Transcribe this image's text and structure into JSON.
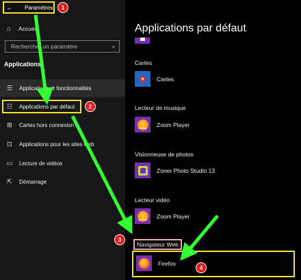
{
  "titlebar": {
    "back_glyph": "←",
    "title": "Paramètres"
  },
  "left": {
    "home_label": "Accueil",
    "search_placeholder": "Rechercher un paramètre",
    "section_heading": "Applications",
    "items": [
      {
        "label": "Applications et fonctionnalités",
        "icon": "apps-list-icon",
        "glyph": "☰"
      },
      {
        "label": "Applications par défaut",
        "icon": "default-apps-icon",
        "glyph": "☷"
      },
      {
        "label": "Cartes hors connexion",
        "icon": "offline-maps-icon",
        "glyph": "⊞"
      },
      {
        "label": "Applications pour les sites web",
        "icon": "apps-websites-icon",
        "glyph": "⊡"
      },
      {
        "label": "Lecture de vidéos",
        "icon": "video-playback-icon",
        "glyph": "▭"
      },
      {
        "label": "Démarrage",
        "icon": "startup-icon",
        "glyph": "⇱"
      }
    ]
  },
  "right": {
    "title": "Applications par défaut",
    "categories": [
      {
        "label": "Cartes",
        "app": "Cartes"
      },
      {
        "label": "Lecteur de musique",
        "app": "Zoom Player"
      },
      {
        "label": "Visionneuse de photos",
        "app": "Zoner Photo Studio 13"
      },
      {
        "label": "Lecteur vidéo",
        "app": "Zoom Player"
      },
      {
        "label": "Navigateur Web",
        "app": "Firefox"
      }
    ],
    "zoom_tile_text": "ZOOM"
  },
  "annotations": [
    "1",
    "2",
    "3",
    "4"
  ],
  "colors": {
    "highlight_yellow": "#f4e52b",
    "highlight_pink": "#f3a7c7",
    "arrow_green": "#33ff33",
    "badge_red": "#e01e1e",
    "tile_purple": "#7a2fb2"
  }
}
